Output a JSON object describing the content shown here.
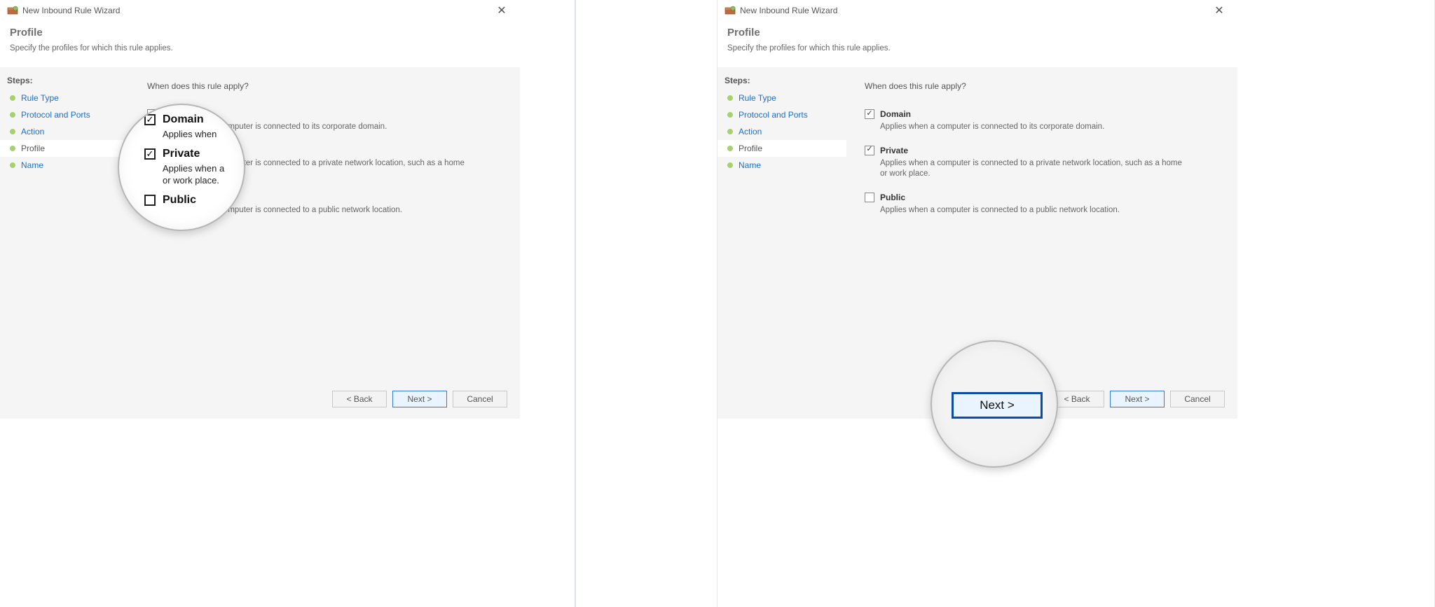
{
  "window": {
    "title": "New Inbound Rule Wizard",
    "page_title": "Profile",
    "page_subtitle": "Specify the profiles for which this rule applies.",
    "close_glyph": "✕"
  },
  "sidebar": {
    "header": "Steps:",
    "items": [
      {
        "label": "Rule Type"
      },
      {
        "label": "Protocol and Ports"
      },
      {
        "label": "Action"
      },
      {
        "label": "Profile"
      },
      {
        "label": "Name"
      }
    ]
  },
  "content": {
    "question": "When does this rule apply?",
    "options": [
      {
        "label": "Domain",
        "desc": "Applies when a computer is connected to its corporate domain.",
        "checked": true
      },
      {
        "label": "Private",
        "desc": "Applies when a computer is connected to a private network location, such as a home or work place.",
        "checked": true
      },
      {
        "label": "Public",
        "desc": "Applies when a computer is connected to a public network location.",
        "checked": false
      }
    ]
  },
  "buttons": {
    "back": "< Back",
    "next": "Next >",
    "cancel": "Cancel"
  },
  "lens_a": {
    "domain_label": "Domain",
    "domain_desc": "Applies when",
    "private_label": "Private",
    "private_desc1": "Applies when a",
    "private_desc2": "or work place.",
    "public_label": "Public"
  },
  "lens_b": {
    "next": "Next >"
  }
}
